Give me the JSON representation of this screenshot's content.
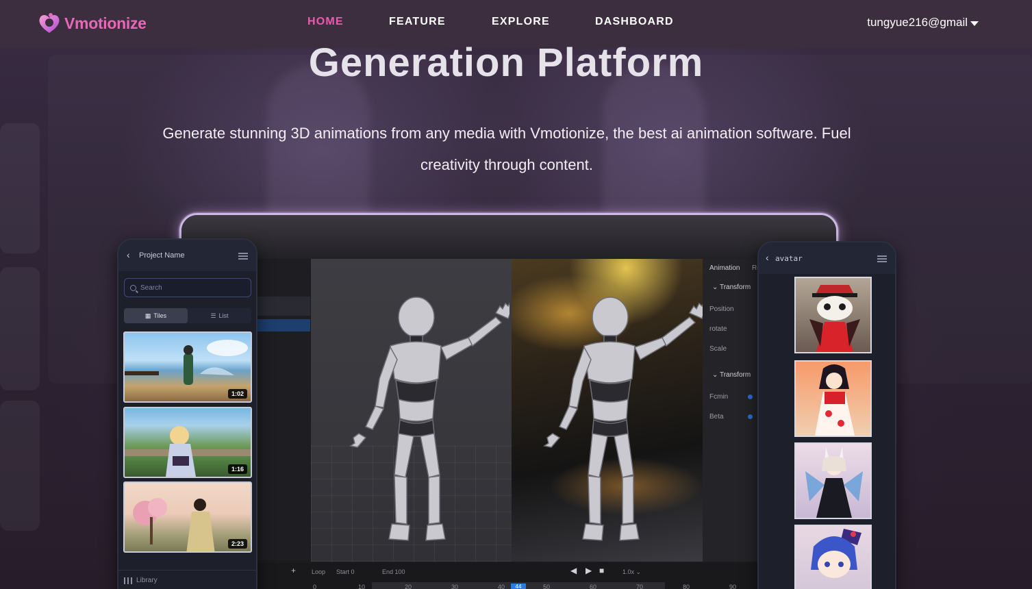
{
  "brand": {
    "name": "Vmotionize",
    "accent": "#e868b8"
  },
  "nav": {
    "links": [
      "HOME",
      "FEATURE",
      "EXPLORE",
      "DASHBOARD"
    ],
    "active": "HOME",
    "user_email": "tungyue216@gmail"
  },
  "hero": {
    "title": "Generation Platform",
    "description": "Generate stunning 3D animations from any media with Vmotionize, the best ai animation software. Fuel creativity through content."
  },
  "left_phone": {
    "title": "Project Name",
    "search_placeholder": "Search",
    "view_tiles": "Tiles",
    "view_list": "List",
    "tiles": [
      {
        "duration": "1:02"
      },
      {
        "duration": "1:16"
      },
      {
        "duration": "2:23"
      }
    ],
    "library_label": "Library"
  },
  "right_phone": {
    "title": "avatar"
  },
  "editor": {
    "panel": {
      "tab_animation": "Animation",
      "tab_re": "Re",
      "transform1": "Transform",
      "position": "Position",
      "rotate": "rotate",
      "scale": "Scale",
      "transform2": "Transform",
      "fcmin": "Fcmin",
      "beta": "Beta"
    },
    "timeline": {
      "loop": "Loop",
      "start": "Start 0",
      "end": "End 100",
      "speed": "1.0x",
      "ticks": [
        "0",
        "10",
        "20",
        "30",
        "40",
        "44",
        "50",
        "60",
        "70",
        "80",
        "90"
      ],
      "current_frame": "44"
    }
  }
}
